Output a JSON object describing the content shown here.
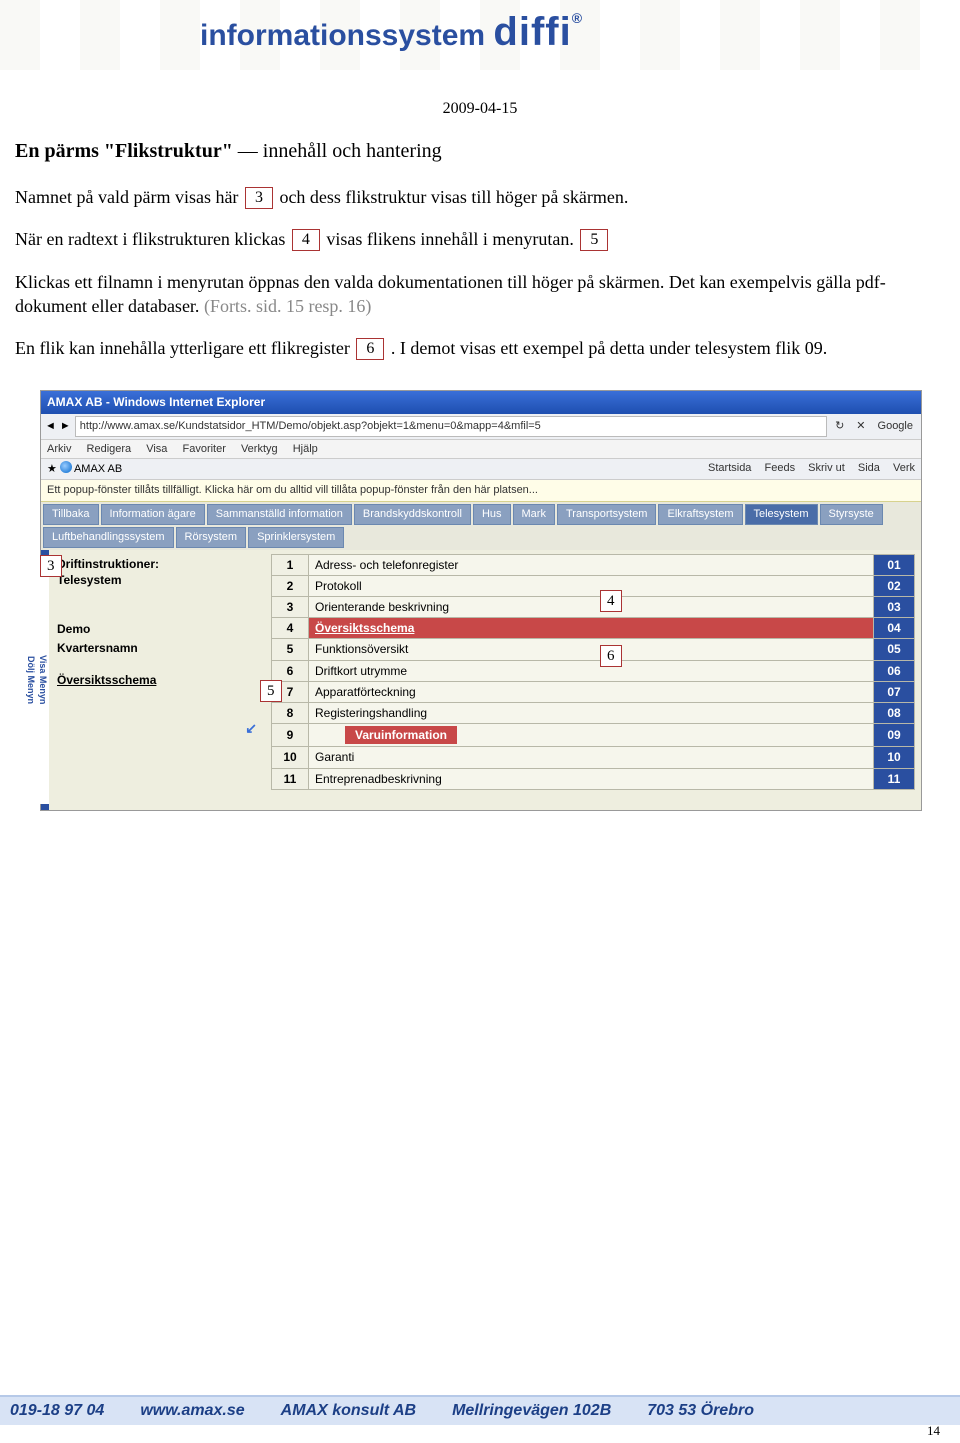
{
  "header": {
    "brand_sys": "informationssystem ",
    "brand_diffi": "diffi",
    "reg": "®",
    "date": "2009-04-15"
  },
  "doc": {
    "h1_bold": "En pärms \"Flikstruktur\"",
    "h1_rest": " — innehåll och hantering",
    "p1_a": "Namnet på vald pärm visas här ",
    "p1_b": " och dess flikstruktur visas till höger på skärmen.",
    "p2_a": "När en radtext i flikstrukturen klickas ",
    "p2_b": " visas flikens innehåll i menyrutan. ",
    "p3": "Klickas ett filnamn i menyrutan öppnas den valda dokumentationen till höger på skärmen. Det kan exempelvis gälla pdf-dokument eller databaser.   ",
    "p3_gray": "(Forts. sid. 15 resp. 16)",
    "p4_a": "En flik kan innehålla ytterligare ett flikregister ",
    "p4_b": ". I demot visas ett exempel på detta under telesystem flik 09.",
    "box3": "3",
    "box4": "4",
    "box5": "5",
    "box6": "6"
  },
  "shot": {
    "title": "AMAX AB - Windows Internet Explorer",
    "url": "http://www.amax.se/Kundstatsidor_HTM/Demo/objekt.asp?objekt=1&menu=0&mapp=4&mfil=5",
    "search": "Google",
    "menu": [
      "Arkiv",
      "Redigera",
      "Visa",
      "Favoriter",
      "Verktyg",
      "Hjälp"
    ],
    "tabfav": "AMAX AB",
    "toolbar": [
      "Startsida",
      "Feeds",
      "Skriv ut",
      "Sida",
      "Verk"
    ],
    "infobar": "Ett popup-fönster tillåts tillfälligt. Klicka här om du alltid vill tillåta popup-fönster från den här platsen...",
    "tabs1": [
      "Tillbaka",
      "Information ägare",
      "Sammanställd information",
      "Brandskyddskontroll",
      "Hus",
      "Mark",
      "Transportsystem",
      "Elkraftsystem",
      "Telesystem",
      "Styrsyste"
    ],
    "tabs2": [
      "Luftbehandlingssystem",
      "Rörsystem",
      "Sprinklersystem"
    ],
    "left": {
      "hdr": "Driftinstruktioner:",
      "sub": "Telesystem",
      "demo_l": "Demo",
      "kv": "Kvartersnamn",
      "ov": "Översiktsschema"
    },
    "rows": [
      {
        "n": "1",
        "name": "Adress- och telefonregister",
        "r": "01"
      },
      {
        "n": "2",
        "name": "Protokoll",
        "r": "02"
      },
      {
        "n": "3",
        "name": "Orienterande beskrivning",
        "r": "03"
      },
      {
        "n": "4",
        "name": "Översiktsschema",
        "r": "04",
        "sel": true,
        "underline": true
      },
      {
        "n": "5",
        "name": "Funktionsöversikt",
        "r": "05"
      },
      {
        "n": "6",
        "name": "Driftkort utrymme",
        "r": "06"
      },
      {
        "n": "7",
        "name": "Apparatförteckning",
        "r": "07"
      },
      {
        "n": "8",
        "name": "Registeringshandling",
        "r": "08"
      },
      {
        "n": "9",
        "name": "Varuinformation",
        "r": "09",
        "sub": true
      },
      {
        "n": "10",
        "name": "Garanti",
        "r": "10"
      },
      {
        "n": "11",
        "name": "Entreprenadbeskrivning",
        "r": "11"
      }
    ],
    "side": {
      "visa": "Visa Menyn",
      "dolj": "Dölj Menyn"
    }
  },
  "footer": {
    "phone": "019-18 97 04",
    "web": "www.amax.se",
    "company": "AMAX konsult AB",
    "addr": "Mellringevägen 102B",
    "city": "703 53 Örebro"
  },
  "pagenum": "14"
}
